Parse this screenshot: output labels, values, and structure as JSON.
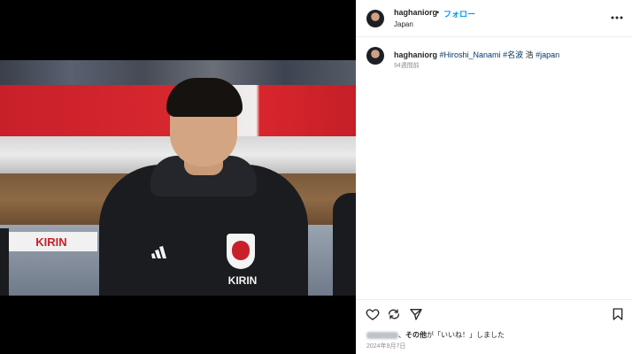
{
  "media": {
    "banner_text": "KIRIN",
    "chest_text": "KIRIN"
  },
  "header": {
    "username": "haghaniorg",
    "separator": "•",
    "follow_label": "フォロー",
    "location": "Japan",
    "more_icon": "more-horizontal-icon"
  },
  "caption": {
    "username": "haghaniorg",
    "tag1": "#Hiroshi_Nanami",
    "tag2": "#名波",
    "text": "浩",
    "tag3": "#japan",
    "time": "94週間前"
  },
  "actions": {
    "icons": [
      "heart-icon",
      "share-loop-icon",
      "send-icon",
      "bookmark-icon"
    ]
  },
  "likes": {
    "others_label": "その他",
    "suffix": "が「いいね！」しました",
    "separator": "、"
  },
  "date": "2024年9月7日",
  "colors": {
    "link": "#0095f6",
    "hashtag": "#00376b",
    "muted": "#8e8e8e"
  }
}
